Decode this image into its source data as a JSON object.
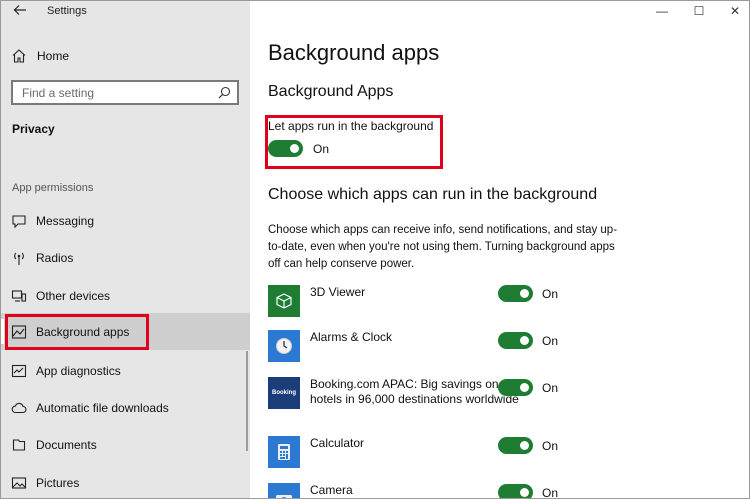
{
  "window": {
    "title": "Settings",
    "min": "—",
    "max": "☐",
    "close": "✕"
  },
  "sidebar": {
    "home": "Home",
    "search_placeholder": "Find a setting",
    "section": "Privacy",
    "group": "App permissions",
    "items": [
      {
        "label": "Messaging",
        "icon": "message-icon"
      },
      {
        "label": "Radios",
        "icon": "radio-tower-icon"
      },
      {
        "label": "Other devices",
        "icon": "devices-icon"
      },
      {
        "label": "Background apps",
        "icon": "background-apps-icon",
        "selected": true
      },
      {
        "label": "App diagnostics",
        "icon": "diagnostics-icon"
      },
      {
        "label": "Automatic file downloads",
        "icon": "cloud-icon"
      },
      {
        "label": "Documents",
        "icon": "document-icon"
      },
      {
        "label": "Pictures",
        "icon": "picture-icon"
      }
    ]
  },
  "main": {
    "title": "Background apps",
    "subtitle": "Background Apps",
    "master_toggle": {
      "caption": "Let apps run in the background",
      "state": "On"
    },
    "heading": "Choose which apps can run in the background",
    "description": "Choose which apps can receive info, send notifications, and stay up-to-date, even when you're not using them. Turning background apps off can help conserve power.",
    "apps": [
      {
        "name": "3D Viewer",
        "state": "On",
        "color": "#1e7d32"
      },
      {
        "name": "Alarms & Clock",
        "state": "On",
        "color": "#2b79d3"
      },
      {
        "name": "Booking.com APAC: Big savings on hotels in 96,000 destinations worldwide",
        "state": "On",
        "color": "#1b3e7a",
        "icon_text": "Booking"
      },
      {
        "name": "Calculator",
        "state": "On",
        "color": "#2b79d3"
      },
      {
        "name": "Camera",
        "state": "On",
        "color": "#2b79d3"
      }
    ]
  },
  "colors": {
    "accent": "#1e7d32",
    "highlight": "#e0001b"
  }
}
